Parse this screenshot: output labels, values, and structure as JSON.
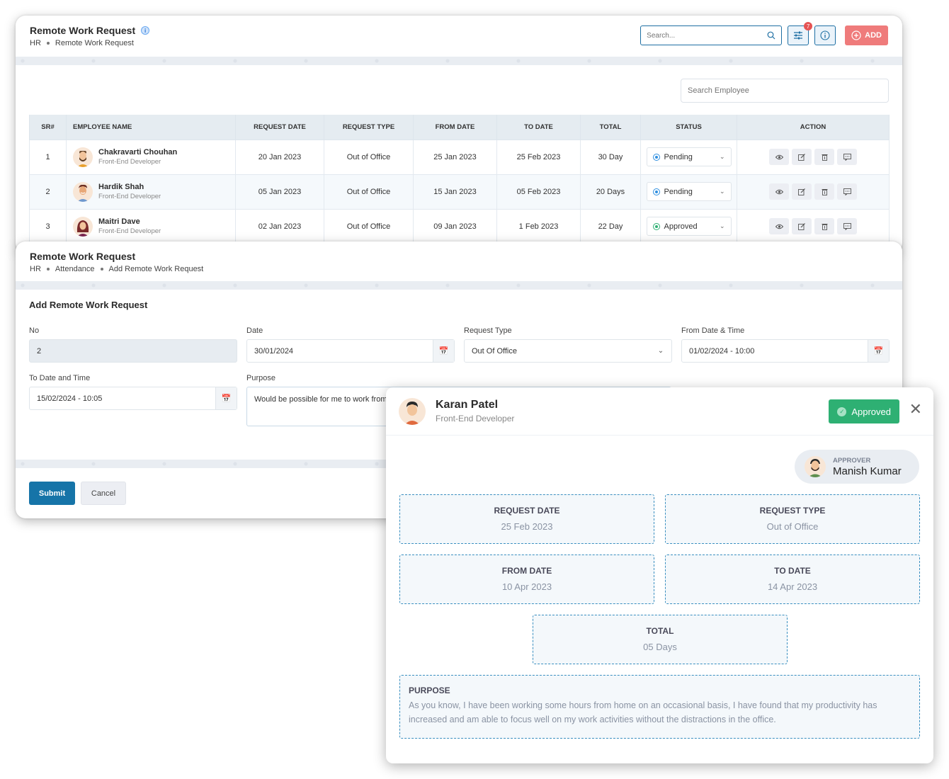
{
  "list_page": {
    "title": "Remote Work Request",
    "breadcrumb": [
      "HR",
      "Remote Work Request"
    ],
    "search_placeholder": "Search...",
    "filter_badge_count": "7",
    "add_label": "ADD",
    "employee_search_placeholder": "Search Employee",
    "columns": [
      "SR#",
      "EMPLOYEE NAME",
      "REQUEST DATE",
      "REQUEST TYPE",
      "FROM DATE",
      "TO DATE",
      "TOTAL",
      "STATUS",
      "ACTION"
    ],
    "rows": [
      {
        "sr": "1",
        "name": "Chakravarti Chouhan",
        "role": "Front-End Developer",
        "request_date": "20 Jan 2023",
        "request_type": "Out of Office",
        "from_date": "25 Jan 2023",
        "to_date": "25 Feb 2023",
        "total": "30 Day",
        "status": "Pending"
      },
      {
        "sr": "2",
        "name": "Hardik Shah",
        "role": "Front-End Developer",
        "request_date": "05 Jan 2023",
        "request_type": "Out of Office",
        "from_date": "15 Jan 2023",
        "to_date": "05 Feb 2023",
        "total": "20 Days",
        "status": "Pending"
      },
      {
        "sr": "3",
        "name": "Maitri Dave",
        "role": "Front-End Developer",
        "request_date": "02 Jan 2023",
        "request_type": "Out of Office",
        "from_date": "09 Jan 2023",
        "to_date": "1 Feb 2023",
        "total": "22 Day",
        "status": "Approved"
      }
    ],
    "status_colors": {
      "Pending": "#2f8fe0",
      "Approved": "#2eb073"
    }
  },
  "form_page": {
    "title": "Remote Work Request",
    "breadcrumb": [
      "HR",
      "Attendance",
      "Add Remote Work Request"
    ],
    "form_title": "Add Remote Work Request",
    "fields": {
      "no": {
        "label": "No",
        "value": "2"
      },
      "date": {
        "label": "Date",
        "value": "30/01/2024"
      },
      "request_type": {
        "label": "Request Type",
        "value": "Out Of Office"
      },
      "from_datetime": {
        "label": "From Date & Time",
        "value": "01/02/2024 - 10:00"
      },
      "to_datetime": {
        "label": "To Date and Time",
        "value": "15/02/2024 - 10:05"
      },
      "purpose": {
        "label": "Purpose",
        "value": "Would be possible for me to work from home regularly, meeting in the office on an as-needed basis"
      }
    },
    "submit_label": "Submit",
    "cancel_label": "Cancel"
  },
  "detail_card": {
    "name": "Karan Patel",
    "role": "Front-End Developer",
    "status": "Approved",
    "approver_label": "APPROVER",
    "approver_name": "Manish Kumar",
    "request_date": {
      "label": "REQUEST DATE",
      "value": "25 Feb 2023"
    },
    "request_type": {
      "label": "REQUEST TYPE",
      "value": "Out of Office"
    },
    "from_date": {
      "label": "FROM DATE",
      "value": "10 Apr 2023"
    },
    "to_date": {
      "label": "TO DATE",
      "value": "14 Apr 2023"
    },
    "total": {
      "label": "TOTAL",
      "value": "05 Days"
    },
    "purpose": {
      "label": "PURPOSE",
      "value": "As you know, I have been working some hours from home on an occasional basis, I have found that my productivity has increased and am able to focus well on my work activities without the distractions in the office."
    }
  },
  "colors": {
    "primary": "#1674a8",
    "add": "#ef7b7b",
    "approved": "#2eb073",
    "pending": "#2f8fe0"
  }
}
